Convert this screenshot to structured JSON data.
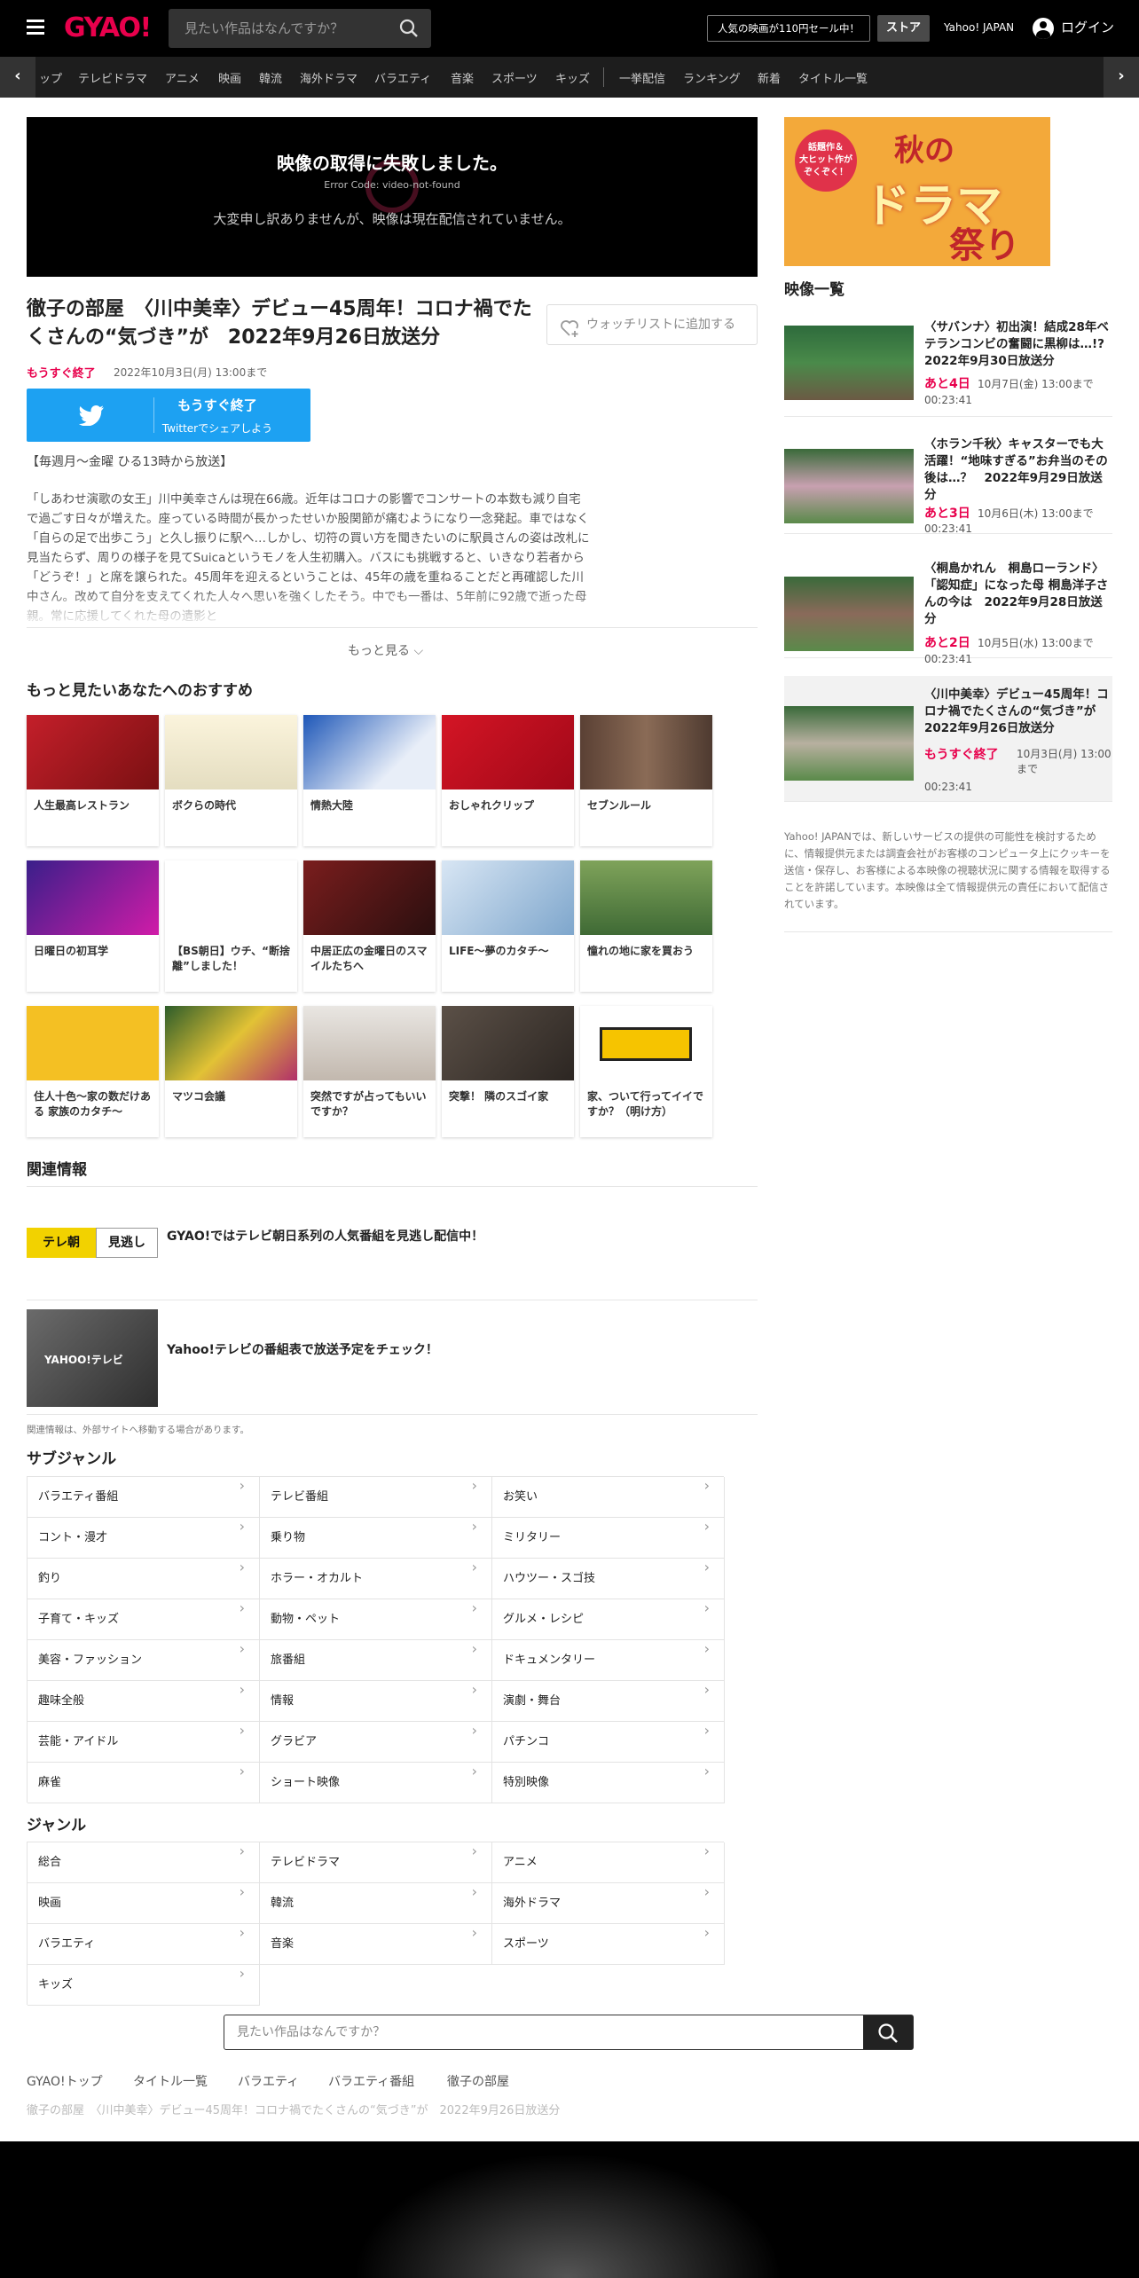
{
  "header": {
    "logo": "GYAO!",
    "search_placeholder": "見たい作品はなんですか？",
    "sale_link": "人気の映画が110円セール中！",
    "store_label": "ストア",
    "yahoo_label": "Yahoo! JAPAN",
    "login_label": "ログイン"
  },
  "nav": {
    "items": [
      "トップ",
      "テレビドラマ",
      "アニメ",
      "映画",
      "韓流",
      "海外ドラマ",
      "バラエティ",
      "音楽",
      "スポーツ",
      "キッズ",
      "一挙配信",
      "ランキング",
      "新着",
      "タイトル一覧"
    ]
  },
  "player": {
    "error_title": "映像の取得に失敗しました。",
    "error_code": "Error Code: video-not-found",
    "error_message": "大変申し訳ありませんが、映像は現在配信されていません。"
  },
  "episode": {
    "title": "徹子の部屋　〈川中美幸〉デビュー45周年！コロナ禍でたくさんの“気づき”が　2022年9月26日放送分",
    "watchlist_label": "ウォッチリストに追加する",
    "status": "もうすぐ終了",
    "end_date": "2022年10月3日(月) 13:00まで",
    "twitter_line1": "もうすぐ終了",
    "twitter_line2": "Twitterでシェアしよう",
    "broadcast_note": "【毎週月～金曜 ひる13時から放送】",
    "description": "「しあわせ演歌の女王」川中美幸さんは現在66歳。近年はコロナの影響でコンサートの本数も減り自宅で過ごす日々が増えた。座っている時間が長かったせいか股関節が痛むようになり一念発起。車ではなく「自らの足で出歩こう」と久し振りに駅へ…しかし、切符の買い方を聞きたいのに駅員さんの姿は改札に見当たらず、周りの様子を見てSuicaというモノを人生初購入。バスにも挑戦すると、いきなり若者から「どうぞ！」と席を譲られた。45周年を迎えるということは、45年の歳を重ねることだと再確認した川中さん。改めて自分を支えてくれた人々へ思いを強くしたそう。中でも一番は、5年前に92歳で逝った母親。常に応援してくれた母の遺影と",
    "more_label": "もっと見る"
  },
  "recommend": {
    "heading": "もっと見たいあなたへのおすすめ",
    "items": [
      {
        "label": "人生最高レストラン"
      },
      {
        "label": "ボクらの時代"
      },
      {
        "label": "情熱大陸"
      },
      {
        "label": "おしゃれクリップ"
      },
      {
        "label": "セブンルール"
      },
      {
        "label": "日曜日の初耳学"
      },
      {
        "label": "【BS朝日】ウチ、“断捨離”しました！"
      },
      {
        "label": "中居正広の金曜日のスマイルたちへ"
      },
      {
        "label": "LIFE～夢のカタチ～"
      },
      {
        "label": "憧れの地に家を買おう"
      },
      {
        "label": "住人十色～家の数だけある 家族のカタチ～"
      },
      {
        "label": "マツコ会議"
      },
      {
        "label": "突然ですが占ってもいいですか？"
      },
      {
        "label": "突撃！ 隣のスゴイ家"
      },
      {
        "label": "家、ついて行ってイイですか？（明け方）"
      }
    ]
  },
  "related": {
    "heading": "関連情報",
    "item1_logo": "テレ朝",
    "item1_logo2": "見逃し",
    "item1_text": "GYAO!ではテレビ朝日系列の人気番組を見逃し配信中！",
    "item2_logo": "YAHOO!テレビ",
    "item2_text": "Yahoo!テレビの番組表で放送予定をチェック！",
    "note": "関連情報は、外部サイトへ移動する場合があります。"
  },
  "subgenre": {
    "heading": "サブジャンル",
    "items": [
      "バラエティ番組",
      "テレビ番組",
      "お笑い",
      "コント・漫才",
      "乗り物",
      "ミリタリー",
      "釣り",
      "ホラー・オカルト",
      "ハウツー・スゴ技",
      "子育て・キッズ",
      "動物・ペット",
      "グルメ・レシピ",
      "美容・ファッション",
      "旅番組",
      "ドキュメンタリー",
      "趣味全般",
      "情報",
      "演劇・舞台",
      "芸能・アイドル",
      "グラビア",
      "パチンコ",
      "麻雀",
      "ショート映像",
      "特別映像"
    ]
  },
  "genre": {
    "heading": "ジャンル",
    "items": [
      "総合",
      "テレビドラマ",
      "アニメ",
      "映画",
      "韓流",
      "海外ドラマ",
      "バラエティ",
      "音楽",
      "スポーツ",
      "キッズ"
    ]
  },
  "bottom_search": {
    "placeholder": "見たい作品はなんですか？"
  },
  "breadcrumb": {
    "items": [
      "GYAO!トップ",
      "タイトル一覧",
      "バラエティ",
      "バラエティ番組",
      "徹子の部屋"
    ],
    "current": "徹子の部屋　〈川中美幸〉デビュー45周年！コロナ禍でたくさんの“気づき”が　2022年9月26日放送分"
  },
  "sidebar": {
    "banner_line1": "話題作＆",
    "banner_line2": "大ヒット作が",
    "banner_line3": "ぞくぞく！",
    "banner_title1": "秋の",
    "banner_title2": "ドラマ",
    "banner_title3": "祭り",
    "video_list_heading": "映像一覧",
    "videos": [
      {
        "title": "〈サバンナ〉初出演！結成28年ベテランコンビの奮闘に黒柳は…!?　2022年9月30日放送分",
        "status": "あと4日",
        "date": "10月7日(金) 13:00まで",
        "duration": "00:23:41"
      },
      {
        "title": "〈ホラン千秋〉キャスターでも大活躍！“地味すぎる”お弁当のその後は…？　2022年9月29日放送分",
        "status": "あと3日",
        "date": "10月6日(木) 13:00まで",
        "duration": "00:23:41"
      },
      {
        "title": "〈桐島かれん　桐島ローランド〉「認知症」になった母 桐島洋子さんの今は　2022年9月28日放送分",
        "status": "あと2日",
        "date": "10月5日(水) 13:00まで",
        "duration": "00:23:41"
      },
      {
        "title": "〈川中美幸〉デビュー45周年！コロナ禍でたくさんの“気づき”が　2022年9月26日放送分",
        "status": "もうすぐ終了",
        "date": "10月3日(月) 13:00まで",
        "duration": "00:23:41"
      }
    ],
    "note": "Yahoo! JAPANでは、新しいサービスの提供の可能性を検討するために、情報提供元または調査会社がお客様のコンピュータ上にクッキーを送信・保存し、お客様による本映像の視聴状況に関する情報を取得することを許諾しています。本映像は全て情報提供元の責任において配信されています。"
  },
  "colors": {
    "accent": "#e8004c",
    "twitter": "#1da1f2",
    "header_bg": "#000000"
  }
}
